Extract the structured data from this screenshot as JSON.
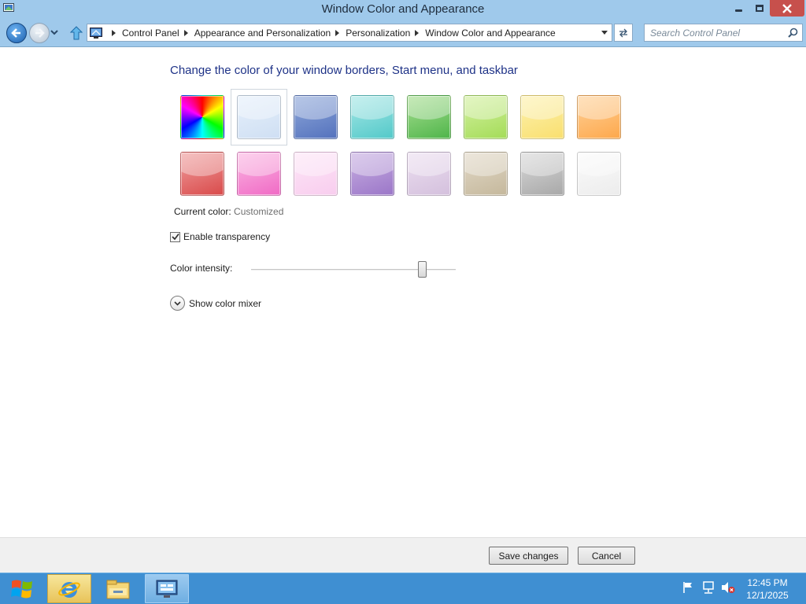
{
  "window": {
    "title": "Window Color and Appearance",
    "icon": "personalization-window-icon",
    "controls": [
      "minimize-icon",
      "restore-icon",
      "close-icon"
    ]
  },
  "nav": {
    "back_icon": "back-arrow-icon",
    "forward_icon": "forward-arrow-icon",
    "up_icon": "up-arrow-icon",
    "breadcrumb": [
      "Control Panel",
      "Appearance and Personalization",
      "Personalization",
      "Window Color and Appearance"
    ],
    "refresh_icon": "refresh-icon",
    "search_placeholder": "Search Control Panel"
  },
  "main": {
    "heading": "Change the color of your window borders, Start menu, and taskbar",
    "swatches": [
      {
        "name": "automatic",
        "colors": [
          "rainbow"
        ]
      },
      {
        "name": "sky",
        "colors": [
          "#e6f0fb",
          "#cfdff3"
        ]
      },
      {
        "name": "twilight",
        "colors": [
          "#8fa8da",
          "#5472bd"
        ]
      },
      {
        "name": "sea-foam",
        "colors": [
          "#a6e7e6",
          "#53c9c9"
        ]
      },
      {
        "name": "leaf",
        "colors": [
          "#a9df92",
          "#4fb54a"
        ]
      },
      {
        "name": "lime",
        "colors": [
          "#d4f1a1",
          "#a4dc58"
        ]
      },
      {
        "name": "sun",
        "colors": [
          "#fdf2b0",
          "#f9df6f"
        ]
      },
      {
        "name": "pumpkin",
        "colors": [
          "#ffd29a",
          "#fda84c"
        ]
      },
      {
        "name": "ruby",
        "colors": [
          "#f0a0a0",
          "#d94a4a"
        ]
      },
      {
        "name": "fuchsia",
        "colors": [
          "#fbb8e3",
          "#f06ac5"
        ]
      },
      {
        "name": "blush",
        "colors": [
          "#fde6f7",
          "#f8cdee"
        ]
      },
      {
        "name": "violet",
        "colors": [
          "#c8b0e2",
          "#9b76c8"
        ]
      },
      {
        "name": "lavender",
        "colors": [
          "#ecdff0",
          "#d4c0dd"
        ]
      },
      {
        "name": "taupe",
        "colors": [
          "#e2d9c8",
          "#c5b89c"
        ]
      },
      {
        "name": "chocolate",
        "colors": [
          "#d9d9d9",
          "#a8a8a8"
        ]
      },
      {
        "name": "frost",
        "colors": [
          "#fbfbfb",
          "#ececec"
        ]
      }
    ],
    "selected_swatch": 1,
    "current_color_label": "Current color:",
    "current_color_value": "Customized",
    "transparency_label": "Enable transparency",
    "transparency_checked": true,
    "intensity_label": "Color intensity:",
    "intensity_value": 0.85,
    "mixer_label": "Show color mixer"
  },
  "footer": {
    "save_label": "Save changes",
    "cancel_label": "Cancel"
  },
  "taskbar": {
    "start_icon": "windows-start-icon",
    "pinned": [
      "internet-explorer-icon",
      "file-explorer-icon",
      "control-panel-icon"
    ],
    "tray_icons": [
      "action-center-flag-icon",
      "network-icon",
      "volume-muted-icon"
    ],
    "time": "12:45 PM",
    "date": "12/1/2025"
  }
}
